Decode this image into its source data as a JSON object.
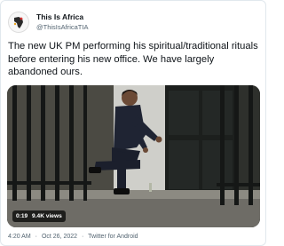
{
  "tweet": {
    "author": {
      "display_name": "This Is Africa",
      "handle": "@ThisIsAfricaTIA"
    },
    "text": "The new UK PM performing his spiritual/traditional rituals before entering his new office. We have largely abandoned ours.",
    "video": {
      "duration": "0:19",
      "views": "9.4K views"
    },
    "meta": {
      "time": "4:20 AM",
      "date": "Oct 26, 2022",
      "client": "Twitter for Android",
      "separator": "·"
    }
  },
  "colors": {
    "text_primary": "#0f1419",
    "text_secondary": "#536471",
    "border": "#e1e8ed",
    "door": "#1c1f1d",
    "railing": "#151716"
  }
}
